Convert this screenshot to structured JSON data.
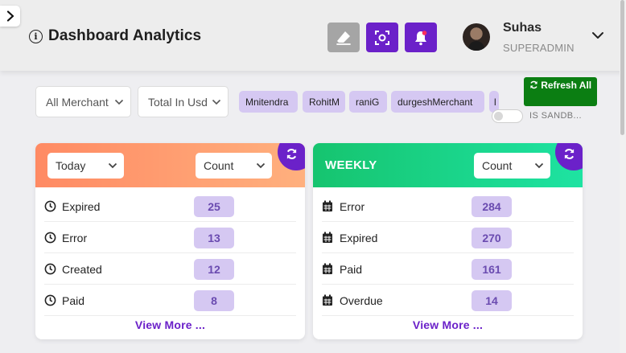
{
  "header": {
    "title": "Dashboard Analytics",
    "user": {
      "name": "Suhas",
      "role": "SUPERADMIN"
    }
  },
  "filters": {
    "merchant_select": "All Merchant",
    "currency_select": "Total In Usd",
    "merchant_chips": [
      "Mnitendra",
      "RohitM",
      "raniG",
      "durgeshMerchant",
      "l"
    ],
    "refresh_label": "Refresh All",
    "sandbox_label": "IS SANDB..."
  },
  "cards": [
    {
      "period": "Today",
      "metric": "Count",
      "rows": [
        {
          "label": "Expired",
          "value": "25"
        },
        {
          "label": "Error",
          "value": "13"
        },
        {
          "label": "Created",
          "value": "12"
        },
        {
          "label": "Paid",
          "value": "8"
        }
      ],
      "view_more": "View More ..."
    },
    {
      "period": "WEEKLY",
      "metric": "Count",
      "rows": [
        {
          "label": "Error",
          "value": "284"
        },
        {
          "label": "Expired",
          "value": "270"
        },
        {
          "label": "Paid",
          "value": "161"
        },
        {
          "label": "Overdue",
          "value": "14"
        }
      ],
      "view_more": "View More ..."
    }
  ],
  "colors": {
    "accent": "#6b21c9",
    "refresh_green": "#0b7e12",
    "chip_bg": "#d5c8f2",
    "today_gradient": [
      "#ff8a63",
      "#ffb07e"
    ],
    "weekly_gradient": [
      "#16c46f",
      "#1ee3a2"
    ]
  },
  "icons": {
    "sidebar_toggle": "chevron-right-icon",
    "info": "info-circle-icon",
    "clear": "eraser-icon",
    "scan": "scan-focus-icon",
    "notifications": "bell-icon",
    "today_rows": "clock-icon",
    "weekly_rows": "calendar-icon",
    "card_refresh": "sync-icon"
  }
}
